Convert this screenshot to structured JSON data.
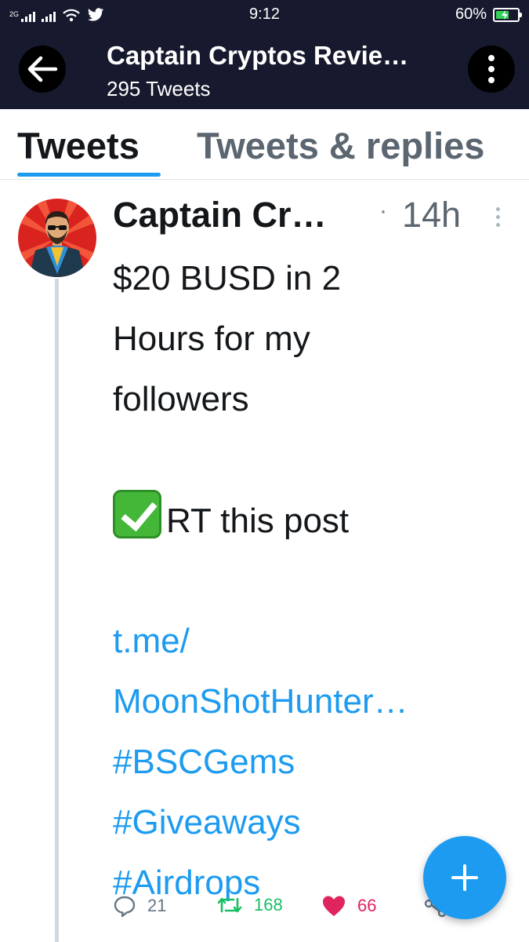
{
  "status_bar": {
    "time": "9:12",
    "battery_percent": "60%",
    "battery_level": 0.6,
    "sim_label": "2G",
    "icons": [
      "signal-icon",
      "signal-icon",
      "wifi-icon",
      "twitter-icon",
      "battery-charging-icon"
    ]
  },
  "header": {
    "title": "Captain Cryptos Revie…",
    "subtitle": "295 Tweets",
    "back_icon": "back-arrow-icon",
    "more_icon": "more-vertical-icon"
  },
  "tabs": [
    {
      "label": "Tweets",
      "active": true
    },
    {
      "label": "Tweets & replies",
      "active": false
    }
  ],
  "tweet": {
    "author": "Captain Cr…",
    "dot": "·",
    "time": "14h",
    "lines": [
      {
        "text": "$20 BUSD in 2",
        "link": false
      },
      {
        "text": "Hours for my",
        "link": false
      },
      {
        "text": "followers",
        "link": false
      },
      {
        "text": "",
        "link": false
      },
      {
        "text": "RT this post",
        "link": false,
        "emoji": "check-mark-button-emoji"
      },
      {
        "text": "",
        "link": false
      },
      {
        "text": "t.me/",
        "link": true
      },
      {
        "text": "MoonShotHunter…",
        "link": true
      },
      {
        "text": "#BSCGems",
        "link": true
      },
      {
        "text": "#Giveaways",
        "link": true
      },
      {
        "text": "#Airdrops",
        "link": true
      }
    ],
    "replies": "21",
    "retweets": "168",
    "likes": "66"
  },
  "colors": {
    "header_bg": "#171a2e",
    "accent": "#1d9bf0",
    "retweet": "#17bf63",
    "like": "#e0245e",
    "muted": "#657786"
  },
  "fab_icon": "plus-icon"
}
